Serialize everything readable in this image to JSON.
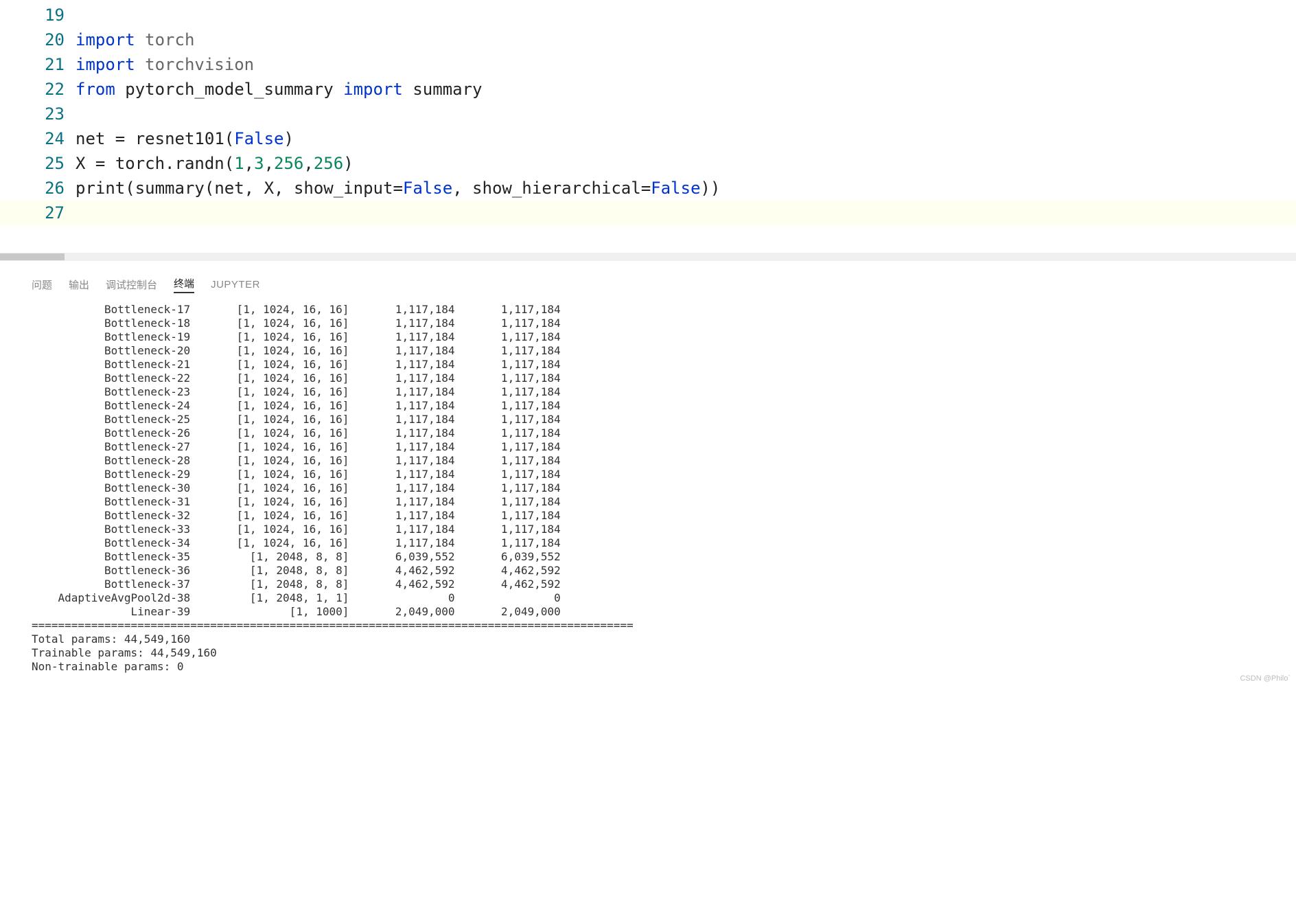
{
  "editor": {
    "lines": [
      {
        "num": "19",
        "tokens": []
      },
      {
        "num": "20",
        "tokens": [
          {
            "cls": "kw",
            "t": "import"
          },
          {
            "cls": "",
            "t": " "
          },
          {
            "cls": "mod",
            "t": "torch"
          }
        ]
      },
      {
        "num": "21",
        "tokens": [
          {
            "cls": "kw",
            "t": "import"
          },
          {
            "cls": "",
            "t": " "
          },
          {
            "cls": "mod",
            "t": "torchvision"
          }
        ]
      },
      {
        "num": "22",
        "tokens": [
          {
            "cls": "kw",
            "t": "from"
          },
          {
            "cls": "",
            "t": " "
          },
          {
            "cls": "fn",
            "t": "pytorch_model_summary"
          },
          {
            "cls": "",
            "t": " "
          },
          {
            "cls": "kw",
            "t": "import"
          },
          {
            "cls": "",
            "t": " "
          },
          {
            "cls": "fn",
            "t": "summary"
          }
        ]
      },
      {
        "num": "23",
        "tokens": []
      },
      {
        "num": "24",
        "tokens": [
          {
            "cls": "fn",
            "t": "net"
          },
          {
            "cls": "eq",
            "t": " = "
          },
          {
            "cls": "fn",
            "t": "resnet101"
          },
          {
            "cls": "paren",
            "t": "("
          },
          {
            "cls": "const",
            "t": "False"
          },
          {
            "cls": "paren",
            "t": ")"
          }
        ]
      },
      {
        "num": "25",
        "tokens": [
          {
            "cls": "fn",
            "t": "X"
          },
          {
            "cls": "eq",
            "t": " = "
          },
          {
            "cls": "fn",
            "t": "torch.randn"
          },
          {
            "cls": "paren",
            "t": "("
          },
          {
            "cls": "num",
            "t": "1"
          },
          {
            "cls": "paren",
            "t": ","
          },
          {
            "cls": "num",
            "t": "3"
          },
          {
            "cls": "paren",
            "t": ","
          },
          {
            "cls": "num",
            "t": "256"
          },
          {
            "cls": "paren",
            "t": ","
          },
          {
            "cls": "num",
            "t": "256"
          },
          {
            "cls": "paren",
            "t": ")"
          }
        ]
      },
      {
        "num": "26",
        "tokens": [
          {
            "cls": "fn",
            "t": "print"
          },
          {
            "cls": "paren",
            "t": "("
          },
          {
            "cls": "fn",
            "t": "summary"
          },
          {
            "cls": "paren",
            "t": "("
          },
          {
            "cls": "fn",
            "t": "net"
          },
          {
            "cls": "paren",
            "t": ", "
          },
          {
            "cls": "fn",
            "t": "X"
          },
          {
            "cls": "paren",
            "t": ", "
          },
          {
            "cls": "fn",
            "t": "show_input"
          },
          {
            "cls": "eq",
            "t": "="
          },
          {
            "cls": "const",
            "t": "False"
          },
          {
            "cls": "paren",
            "t": ", "
          },
          {
            "cls": "fn",
            "t": "show_hierarchical"
          },
          {
            "cls": "eq",
            "t": "="
          },
          {
            "cls": "const",
            "t": "False"
          },
          {
            "cls": "paren",
            "t": "))"
          }
        ]
      },
      {
        "num": "27",
        "tokens": [],
        "hl": true
      }
    ]
  },
  "panel": {
    "tabs": [
      {
        "label": "问题",
        "active": false
      },
      {
        "label": "输出",
        "active": false
      },
      {
        "label": "调试控制台",
        "active": false
      },
      {
        "label": "终端",
        "active": true
      },
      {
        "label": "JUPYTER",
        "active": false,
        "upper": true
      }
    ]
  },
  "terminal": {
    "rows": [
      {
        "layer": "Bottleneck-17",
        "shape": "[1, 1024, 16, 16]",
        "p1": "1,117,184",
        "p2": "1,117,184"
      },
      {
        "layer": "Bottleneck-18",
        "shape": "[1, 1024, 16, 16]",
        "p1": "1,117,184",
        "p2": "1,117,184"
      },
      {
        "layer": "Bottleneck-19",
        "shape": "[1, 1024, 16, 16]",
        "p1": "1,117,184",
        "p2": "1,117,184"
      },
      {
        "layer": "Bottleneck-20",
        "shape": "[1, 1024, 16, 16]",
        "p1": "1,117,184",
        "p2": "1,117,184"
      },
      {
        "layer": "Bottleneck-21",
        "shape": "[1, 1024, 16, 16]",
        "p1": "1,117,184",
        "p2": "1,117,184"
      },
      {
        "layer": "Bottleneck-22",
        "shape": "[1, 1024, 16, 16]",
        "p1": "1,117,184",
        "p2": "1,117,184"
      },
      {
        "layer": "Bottleneck-23",
        "shape": "[1, 1024, 16, 16]",
        "p1": "1,117,184",
        "p2": "1,117,184"
      },
      {
        "layer": "Bottleneck-24",
        "shape": "[1, 1024, 16, 16]",
        "p1": "1,117,184",
        "p2": "1,117,184"
      },
      {
        "layer": "Bottleneck-25",
        "shape": "[1, 1024, 16, 16]",
        "p1": "1,117,184",
        "p2": "1,117,184"
      },
      {
        "layer": "Bottleneck-26",
        "shape": "[1, 1024, 16, 16]",
        "p1": "1,117,184",
        "p2": "1,117,184"
      },
      {
        "layer": "Bottleneck-27",
        "shape": "[1, 1024, 16, 16]",
        "p1": "1,117,184",
        "p2": "1,117,184"
      },
      {
        "layer": "Bottleneck-28",
        "shape": "[1, 1024, 16, 16]",
        "p1": "1,117,184",
        "p2": "1,117,184"
      },
      {
        "layer": "Bottleneck-29",
        "shape": "[1, 1024, 16, 16]",
        "p1": "1,117,184",
        "p2": "1,117,184"
      },
      {
        "layer": "Bottleneck-30",
        "shape": "[1, 1024, 16, 16]",
        "p1": "1,117,184",
        "p2": "1,117,184"
      },
      {
        "layer": "Bottleneck-31",
        "shape": "[1, 1024, 16, 16]",
        "p1": "1,117,184",
        "p2": "1,117,184"
      },
      {
        "layer": "Bottleneck-32",
        "shape": "[1, 1024, 16, 16]",
        "p1": "1,117,184",
        "p2": "1,117,184"
      },
      {
        "layer": "Bottleneck-33",
        "shape": "[1, 1024, 16, 16]",
        "p1": "1,117,184",
        "p2": "1,117,184"
      },
      {
        "layer": "Bottleneck-34",
        "shape": "[1, 1024, 16, 16]",
        "p1": "1,117,184",
        "p2": "1,117,184"
      },
      {
        "layer": "Bottleneck-35",
        "shape": "[1, 2048, 8, 8]",
        "p1": "6,039,552",
        "p2": "6,039,552"
      },
      {
        "layer": "Bottleneck-36",
        "shape": "[1, 2048, 8, 8]",
        "p1": "4,462,592",
        "p2": "4,462,592"
      },
      {
        "layer": "Bottleneck-37",
        "shape": "[1, 2048, 8, 8]",
        "p1": "4,462,592",
        "p2": "4,462,592"
      },
      {
        "layer": "AdaptiveAvgPool2d-38",
        "shape": "[1, 2048, 1, 1]",
        "p1": "0",
        "p2": "0"
      },
      {
        "layer": "Linear-39",
        "shape": "[1, 1000]",
        "p1": "2,049,000",
        "p2": "2,049,000"
      }
    ],
    "separator": "===========================================================================================",
    "summary_lines": [
      "Total params: 44,549,160",
      "Trainable params: 44,549,160",
      "Non-trainable params: 0"
    ],
    "col_widths": {
      "layer": 24,
      "shape": 24,
      "p1": 16,
      "p2": 16
    }
  },
  "watermark": "CSDN @Philo`"
}
